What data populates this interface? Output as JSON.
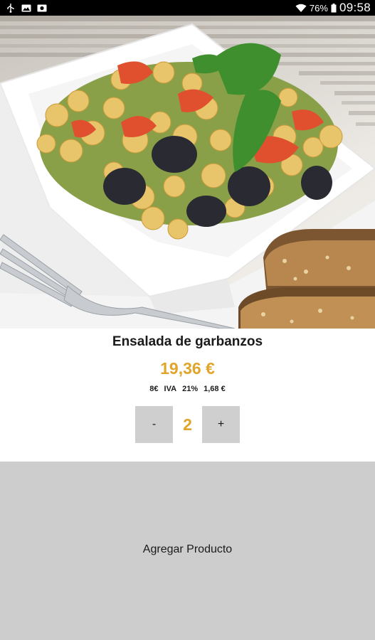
{
  "status_bar": {
    "icons": [
      "usb-icon",
      "image-icon",
      "photo-icon"
    ],
    "wifi_icon": "wifi-icon",
    "battery_percent": "76%",
    "battery_icon": "battery-icon",
    "time": "09:58"
  },
  "product": {
    "image_icon": "chickpea-salad-photo",
    "name": "Ensalada de garbanzos",
    "price": "19,36 €",
    "base_price": "8€",
    "tax_label": "IVA",
    "tax_rate": "21%",
    "tax_amount": "1,68 €"
  },
  "quantity": {
    "decrement_label": "-",
    "value": "2",
    "increment_label": "+"
  },
  "actions": {
    "add_label": "Agregar Producto"
  },
  "colors": {
    "accent": "#e0a52b",
    "button_gray": "#cfcfcf",
    "status_bar_bg": "#000000"
  }
}
